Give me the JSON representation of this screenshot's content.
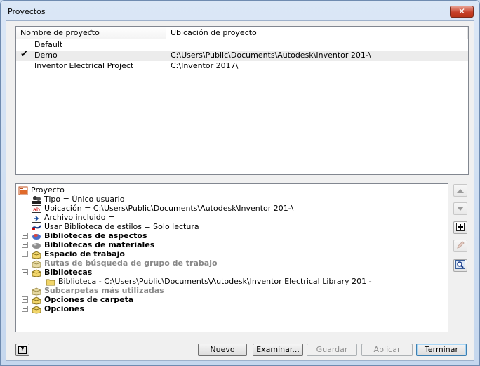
{
  "window": {
    "title": "Proyectos",
    "close_label": "✕"
  },
  "projects": {
    "columns": {
      "name": "Nombre de proyecto",
      "location": "Ubicación de proyecto"
    },
    "rows": [
      {
        "name": "Default",
        "location": "",
        "active": false
      },
      {
        "name": "Demo",
        "location": "C:\\Users\\Public\\Documents\\Autodesk\\Inventor 201-\\",
        "active": true,
        "check": "✔"
      },
      {
        "name": "Inventor Electrical Project",
        "location": "C:\\Inventor 2017\\",
        "active": false
      }
    ]
  },
  "tree": {
    "root": "Proyecto",
    "type": "Tipo = Único usuario",
    "location": "Ubicación = C:\\Users\\Public\\Documents\\Autodesk\\Inventor 201-\\",
    "included_file": "Archivo incluido =",
    "style_library": "Usar Biblioteca de estilos = Solo lectura",
    "appearance_libraries": "Bibliotecas de aspectos",
    "material_libraries": "Bibliotecas de materiales",
    "workspace": "Espacio de trabajo",
    "group_search_paths": "Rutas de búsqueda de grupo de trabajo",
    "libraries": "Bibliotecas",
    "library_entry": "Biblioteca - C:\\Users\\Public\\Documents\\Autodesk\\Inventor Electrical Library 201 -",
    "frequent_subfolders": "Subcarpetas más utilizadas",
    "folder_options": "Opciones de carpeta",
    "options": "Opciones",
    "expanders": {
      "plus": "+",
      "minus": "−"
    }
  },
  "buttons": {
    "help": "?",
    "new": "Nuevo",
    "browse": "Examinar...",
    "save": "Guardar",
    "apply": "Aplicar",
    "finish": "Terminar"
  },
  "colors": {
    "accent": "#3c7fb1",
    "close": "#c7412a",
    "frame": "#c9daef"
  }
}
